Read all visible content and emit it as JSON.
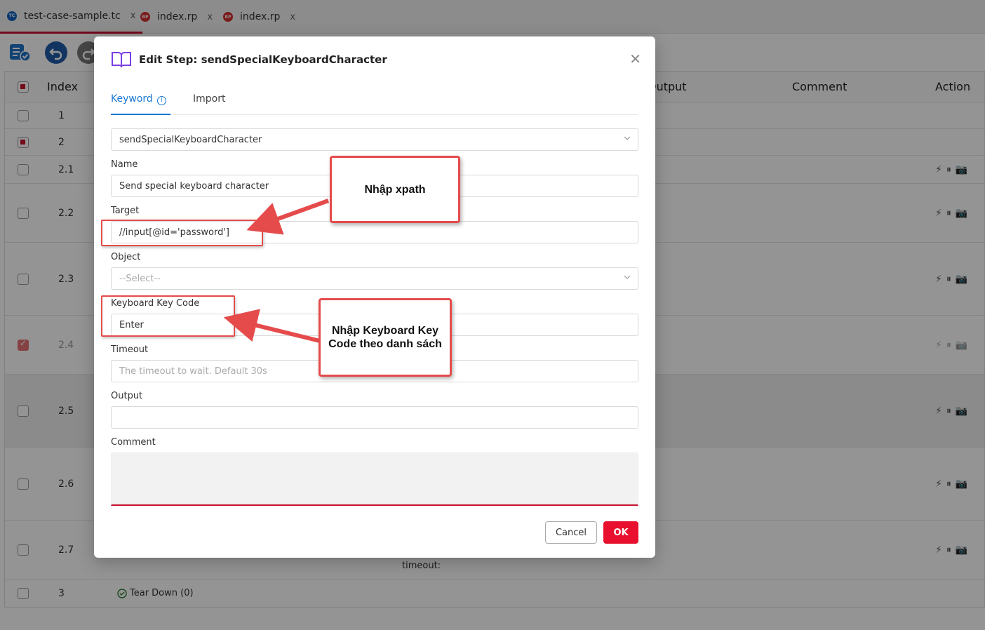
{
  "tabs": [
    {
      "label": "test-case-sample.tc",
      "badge": "TC"
    },
    {
      "label": "index.rp",
      "badge": "RP"
    },
    {
      "label": "index.rp",
      "badge": "RP"
    }
  ],
  "tab_close_glyph": "x",
  "table": {
    "headers": {
      "index": "Index",
      "output": "Output",
      "comment": "Comment",
      "action": "Action"
    },
    "rows": [
      {
        "index": "1"
      },
      {
        "index": "2"
      },
      {
        "index": "2.1"
      },
      {
        "index": "2.2"
      },
      {
        "index": "2.3"
      },
      {
        "index": "2.4"
      },
      {
        "index": "2.5"
      },
      {
        "index": "2.6"
      },
      {
        "index": "2.7"
      },
      {
        "index": "3"
      }
    ],
    "partial_timeout_text": "timeout:",
    "teardown_label": "Tear Down (0)"
  },
  "dialog": {
    "title": "Edit Step: sendSpecialKeyboardCharacter",
    "tabs": {
      "keyword": "Keyword",
      "import": "Import"
    },
    "keyword_value": "sendSpecialKeyboardCharacter",
    "name_label": "Name",
    "name_value": "Send special keyboard character",
    "target_label": "Target",
    "target_value": "//input[@id='password']",
    "object_label": "Object",
    "object_placeholder": "--Select--",
    "key_code_label": "Keyboard Key Code",
    "key_code_value": "Enter",
    "timeout_label": "Timeout",
    "timeout_placeholder": "The timeout to wait. Default 30s",
    "output_label": "Output",
    "output_value": "",
    "comment_label": "Comment",
    "cancel_label": "Cancel",
    "ok_label": "OK"
  },
  "callouts": {
    "xpath": "Nhập xpath",
    "keycode_line1": "Nhập Keyboard Key",
    "keycode_line2": "Code theo danh sách"
  },
  "colors": {
    "accent": "#1976d2",
    "brand_red": "#e8102e",
    "annotation_red": "#e54b4b"
  }
}
